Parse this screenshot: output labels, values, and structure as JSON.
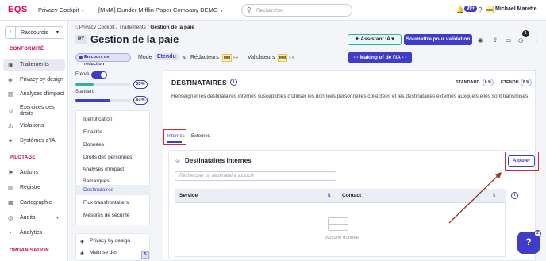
{
  "app": {
    "logo": "EQS"
  },
  "topbar": {
    "product": "Privacy Cockpit",
    "workspace": "[MMA] Dunder Mifflin Paper Company DEMO",
    "search_placeholder": "Rechercher",
    "notifications_count": "99+",
    "user_initials": "MM",
    "user_name": "Michael Marette"
  },
  "sidebar": {
    "shortcut_label": "Raccourcis",
    "sections": [
      {
        "title": "CONFORMITÉ",
        "items": [
          {
            "label": "Traitements",
            "icon": "folder-icon",
            "active": true
          },
          {
            "label": "Privacy by design",
            "icon": "shield-icon"
          },
          {
            "label": "Analyses d'impact",
            "icon": "chart-icon"
          },
          {
            "label": "Exercices des droits",
            "icon": "user-check-icon"
          },
          {
            "label": "Violations",
            "icon": "alert-icon"
          },
          {
            "label": "Systèmes d'IA",
            "icon": "sparkle-icon"
          }
        ]
      },
      {
        "title": "PILOTAGE",
        "items": [
          {
            "label": "Actions",
            "icon": "flag-icon"
          },
          {
            "label": "Registre",
            "icon": "book-icon"
          },
          {
            "label": "Cartographie",
            "icon": "map-icon"
          },
          {
            "label": "Audits",
            "icon": "audit-icon"
          },
          {
            "label": "Analytics",
            "icon": "analytics-icon"
          }
        ]
      },
      {
        "title": "ORGANISATION",
        "items": []
      }
    ]
  },
  "breadcrumb": [
    "Privacy Cockpit",
    "Traitements",
    "Gestion de la paie"
  ],
  "header": {
    "badge": "RT",
    "title": "Gestion de la paie",
    "assistant_label": "Assistant IA",
    "submit_label": "Soumettre pour validation",
    "notif_count": "1",
    "status": "En cours de réduction",
    "mode_label": "Mode",
    "mode_value": "Etendu",
    "redacteurs_label": "Rédacteurs",
    "validateurs_label": "Validateurs",
    "redacteur_initials": "MM",
    "validateur_initials": "MM",
    "making_label": "- - Making of de l'IA - -"
  },
  "progress": {
    "toggle_label": "Etendu",
    "etendu_pct": "33%",
    "etendu_value": 0.33,
    "standard_label": "Standard",
    "standard_pct": "63%",
    "standard_value": 0.63
  },
  "left_menu": [
    "Identification",
    "Finalités",
    "Données",
    "Droits des personnes",
    "Destinataires",
    "Flux transfrontaliers",
    "Mesures de sécurité",
    "Analyses d'impact",
    "Remarques"
  ],
  "left_menu_active": "Destinataires",
  "left_menu2": [
    {
      "label": "Privacy by design"
    },
    {
      "label": "Maîtrise des",
      "count": "5"
    }
  ],
  "panel": {
    "title": "DESTINATAIRES",
    "standard_label": "STANDARD",
    "standard_pct": "0 %",
    "etendu_label": "ETENDU",
    "etendu_pct": "0 %",
    "description": "Renseigner les destinataires internes susceptibles d'utiliser les données personnelles collectées et les destinataires externes auxquels elles sont transmises.",
    "tabs": [
      "Internes",
      "Externes"
    ],
    "section_title": "Destinataires internes",
    "add_button": "Ajouter",
    "search_placeholder": "Rechercher un destinataire associé",
    "columns": [
      "Service",
      "Contact"
    ],
    "empty_text": "Aucune donnée"
  },
  "chat": {
    "badge": "2"
  },
  "colors": {
    "accent": "#3f3dc8",
    "brand": "#e5004c",
    "annotation": "#d42a2a",
    "teal": "#2fb3a3"
  }
}
